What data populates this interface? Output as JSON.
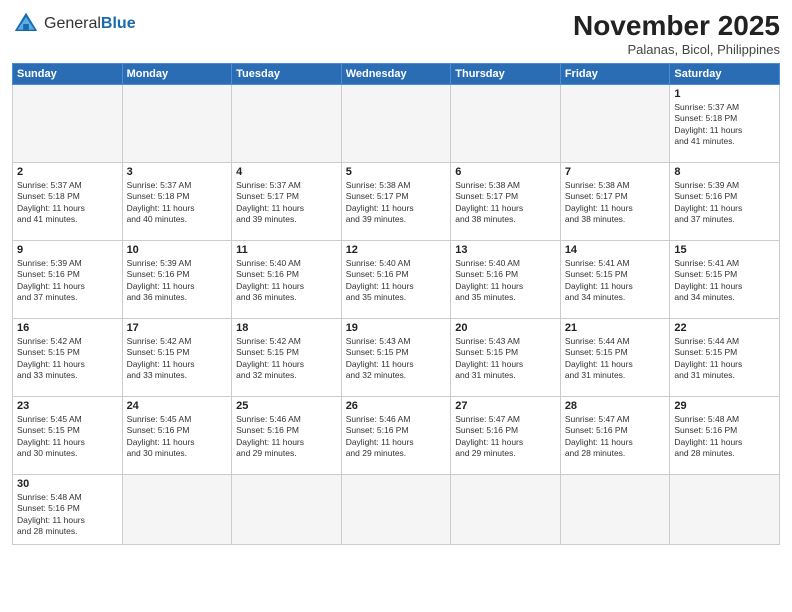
{
  "header": {
    "logo_general": "General",
    "logo_blue": "Blue",
    "month_title": "November 2025",
    "subtitle": "Palanas, Bicol, Philippines"
  },
  "days_of_week": [
    "Sunday",
    "Monday",
    "Tuesday",
    "Wednesday",
    "Thursday",
    "Friday",
    "Saturday"
  ],
  "weeks": [
    [
      {
        "day": "",
        "info": ""
      },
      {
        "day": "",
        "info": ""
      },
      {
        "day": "",
        "info": ""
      },
      {
        "day": "",
        "info": ""
      },
      {
        "day": "",
        "info": ""
      },
      {
        "day": "",
        "info": ""
      },
      {
        "day": "1",
        "info": "Sunrise: 5:37 AM\nSunset: 5:18 PM\nDaylight: 11 hours\nand 41 minutes."
      }
    ],
    [
      {
        "day": "2",
        "info": "Sunrise: 5:37 AM\nSunset: 5:18 PM\nDaylight: 11 hours\nand 41 minutes."
      },
      {
        "day": "3",
        "info": "Sunrise: 5:37 AM\nSunset: 5:18 PM\nDaylight: 11 hours\nand 40 minutes."
      },
      {
        "day": "4",
        "info": "Sunrise: 5:37 AM\nSunset: 5:17 PM\nDaylight: 11 hours\nand 39 minutes."
      },
      {
        "day": "5",
        "info": "Sunrise: 5:38 AM\nSunset: 5:17 PM\nDaylight: 11 hours\nand 39 minutes."
      },
      {
        "day": "6",
        "info": "Sunrise: 5:38 AM\nSunset: 5:17 PM\nDaylight: 11 hours\nand 38 minutes."
      },
      {
        "day": "7",
        "info": "Sunrise: 5:38 AM\nSunset: 5:17 PM\nDaylight: 11 hours\nand 38 minutes."
      },
      {
        "day": "8",
        "info": "Sunrise: 5:39 AM\nSunset: 5:16 PM\nDaylight: 11 hours\nand 37 minutes."
      }
    ],
    [
      {
        "day": "9",
        "info": "Sunrise: 5:39 AM\nSunset: 5:16 PM\nDaylight: 11 hours\nand 37 minutes."
      },
      {
        "day": "10",
        "info": "Sunrise: 5:39 AM\nSunset: 5:16 PM\nDaylight: 11 hours\nand 36 minutes."
      },
      {
        "day": "11",
        "info": "Sunrise: 5:40 AM\nSunset: 5:16 PM\nDaylight: 11 hours\nand 36 minutes."
      },
      {
        "day": "12",
        "info": "Sunrise: 5:40 AM\nSunset: 5:16 PM\nDaylight: 11 hours\nand 35 minutes."
      },
      {
        "day": "13",
        "info": "Sunrise: 5:40 AM\nSunset: 5:16 PM\nDaylight: 11 hours\nand 35 minutes."
      },
      {
        "day": "14",
        "info": "Sunrise: 5:41 AM\nSunset: 5:15 PM\nDaylight: 11 hours\nand 34 minutes."
      },
      {
        "day": "15",
        "info": "Sunrise: 5:41 AM\nSunset: 5:15 PM\nDaylight: 11 hours\nand 34 minutes."
      }
    ],
    [
      {
        "day": "16",
        "info": "Sunrise: 5:42 AM\nSunset: 5:15 PM\nDaylight: 11 hours\nand 33 minutes."
      },
      {
        "day": "17",
        "info": "Sunrise: 5:42 AM\nSunset: 5:15 PM\nDaylight: 11 hours\nand 33 minutes."
      },
      {
        "day": "18",
        "info": "Sunrise: 5:42 AM\nSunset: 5:15 PM\nDaylight: 11 hours\nand 32 minutes."
      },
      {
        "day": "19",
        "info": "Sunrise: 5:43 AM\nSunset: 5:15 PM\nDaylight: 11 hours\nand 32 minutes."
      },
      {
        "day": "20",
        "info": "Sunrise: 5:43 AM\nSunset: 5:15 PM\nDaylight: 11 hours\nand 31 minutes."
      },
      {
        "day": "21",
        "info": "Sunrise: 5:44 AM\nSunset: 5:15 PM\nDaylight: 11 hours\nand 31 minutes."
      },
      {
        "day": "22",
        "info": "Sunrise: 5:44 AM\nSunset: 5:15 PM\nDaylight: 11 hours\nand 31 minutes."
      }
    ],
    [
      {
        "day": "23",
        "info": "Sunrise: 5:45 AM\nSunset: 5:15 PM\nDaylight: 11 hours\nand 30 minutes."
      },
      {
        "day": "24",
        "info": "Sunrise: 5:45 AM\nSunset: 5:16 PM\nDaylight: 11 hours\nand 30 minutes."
      },
      {
        "day": "25",
        "info": "Sunrise: 5:46 AM\nSunset: 5:16 PM\nDaylight: 11 hours\nand 29 minutes."
      },
      {
        "day": "26",
        "info": "Sunrise: 5:46 AM\nSunset: 5:16 PM\nDaylight: 11 hours\nand 29 minutes."
      },
      {
        "day": "27",
        "info": "Sunrise: 5:47 AM\nSunset: 5:16 PM\nDaylight: 11 hours\nand 29 minutes."
      },
      {
        "day": "28",
        "info": "Sunrise: 5:47 AM\nSunset: 5:16 PM\nDaylight: 11 hours\nand 28 minutes."
      },
      {
        "day": "29",
        "info": "Sunrise: 5:48 AM\nSunset: 5:16 PM\nDaylight: 11 hours\nand 28 minutes."
      }
    ],
    [
      {
        "day": "30",
        "info": "Sunrise: 5:48 AM\nSunset: 5:16 PM\nDaylight: 11 hours\nand 28 minutes."
      },
      {
        "day": "",
        "info": ""
      },
      {
        "day": "",
        "info": ""
      },
      {
        "day": "",
        "info": ""
      },
      {
        "day": "",
        "info": ""
      },
      {
        "day": "",
        "info": ""
      },
      {
        "day": "",
        "info": ""
      }
    ]
  ]
}
